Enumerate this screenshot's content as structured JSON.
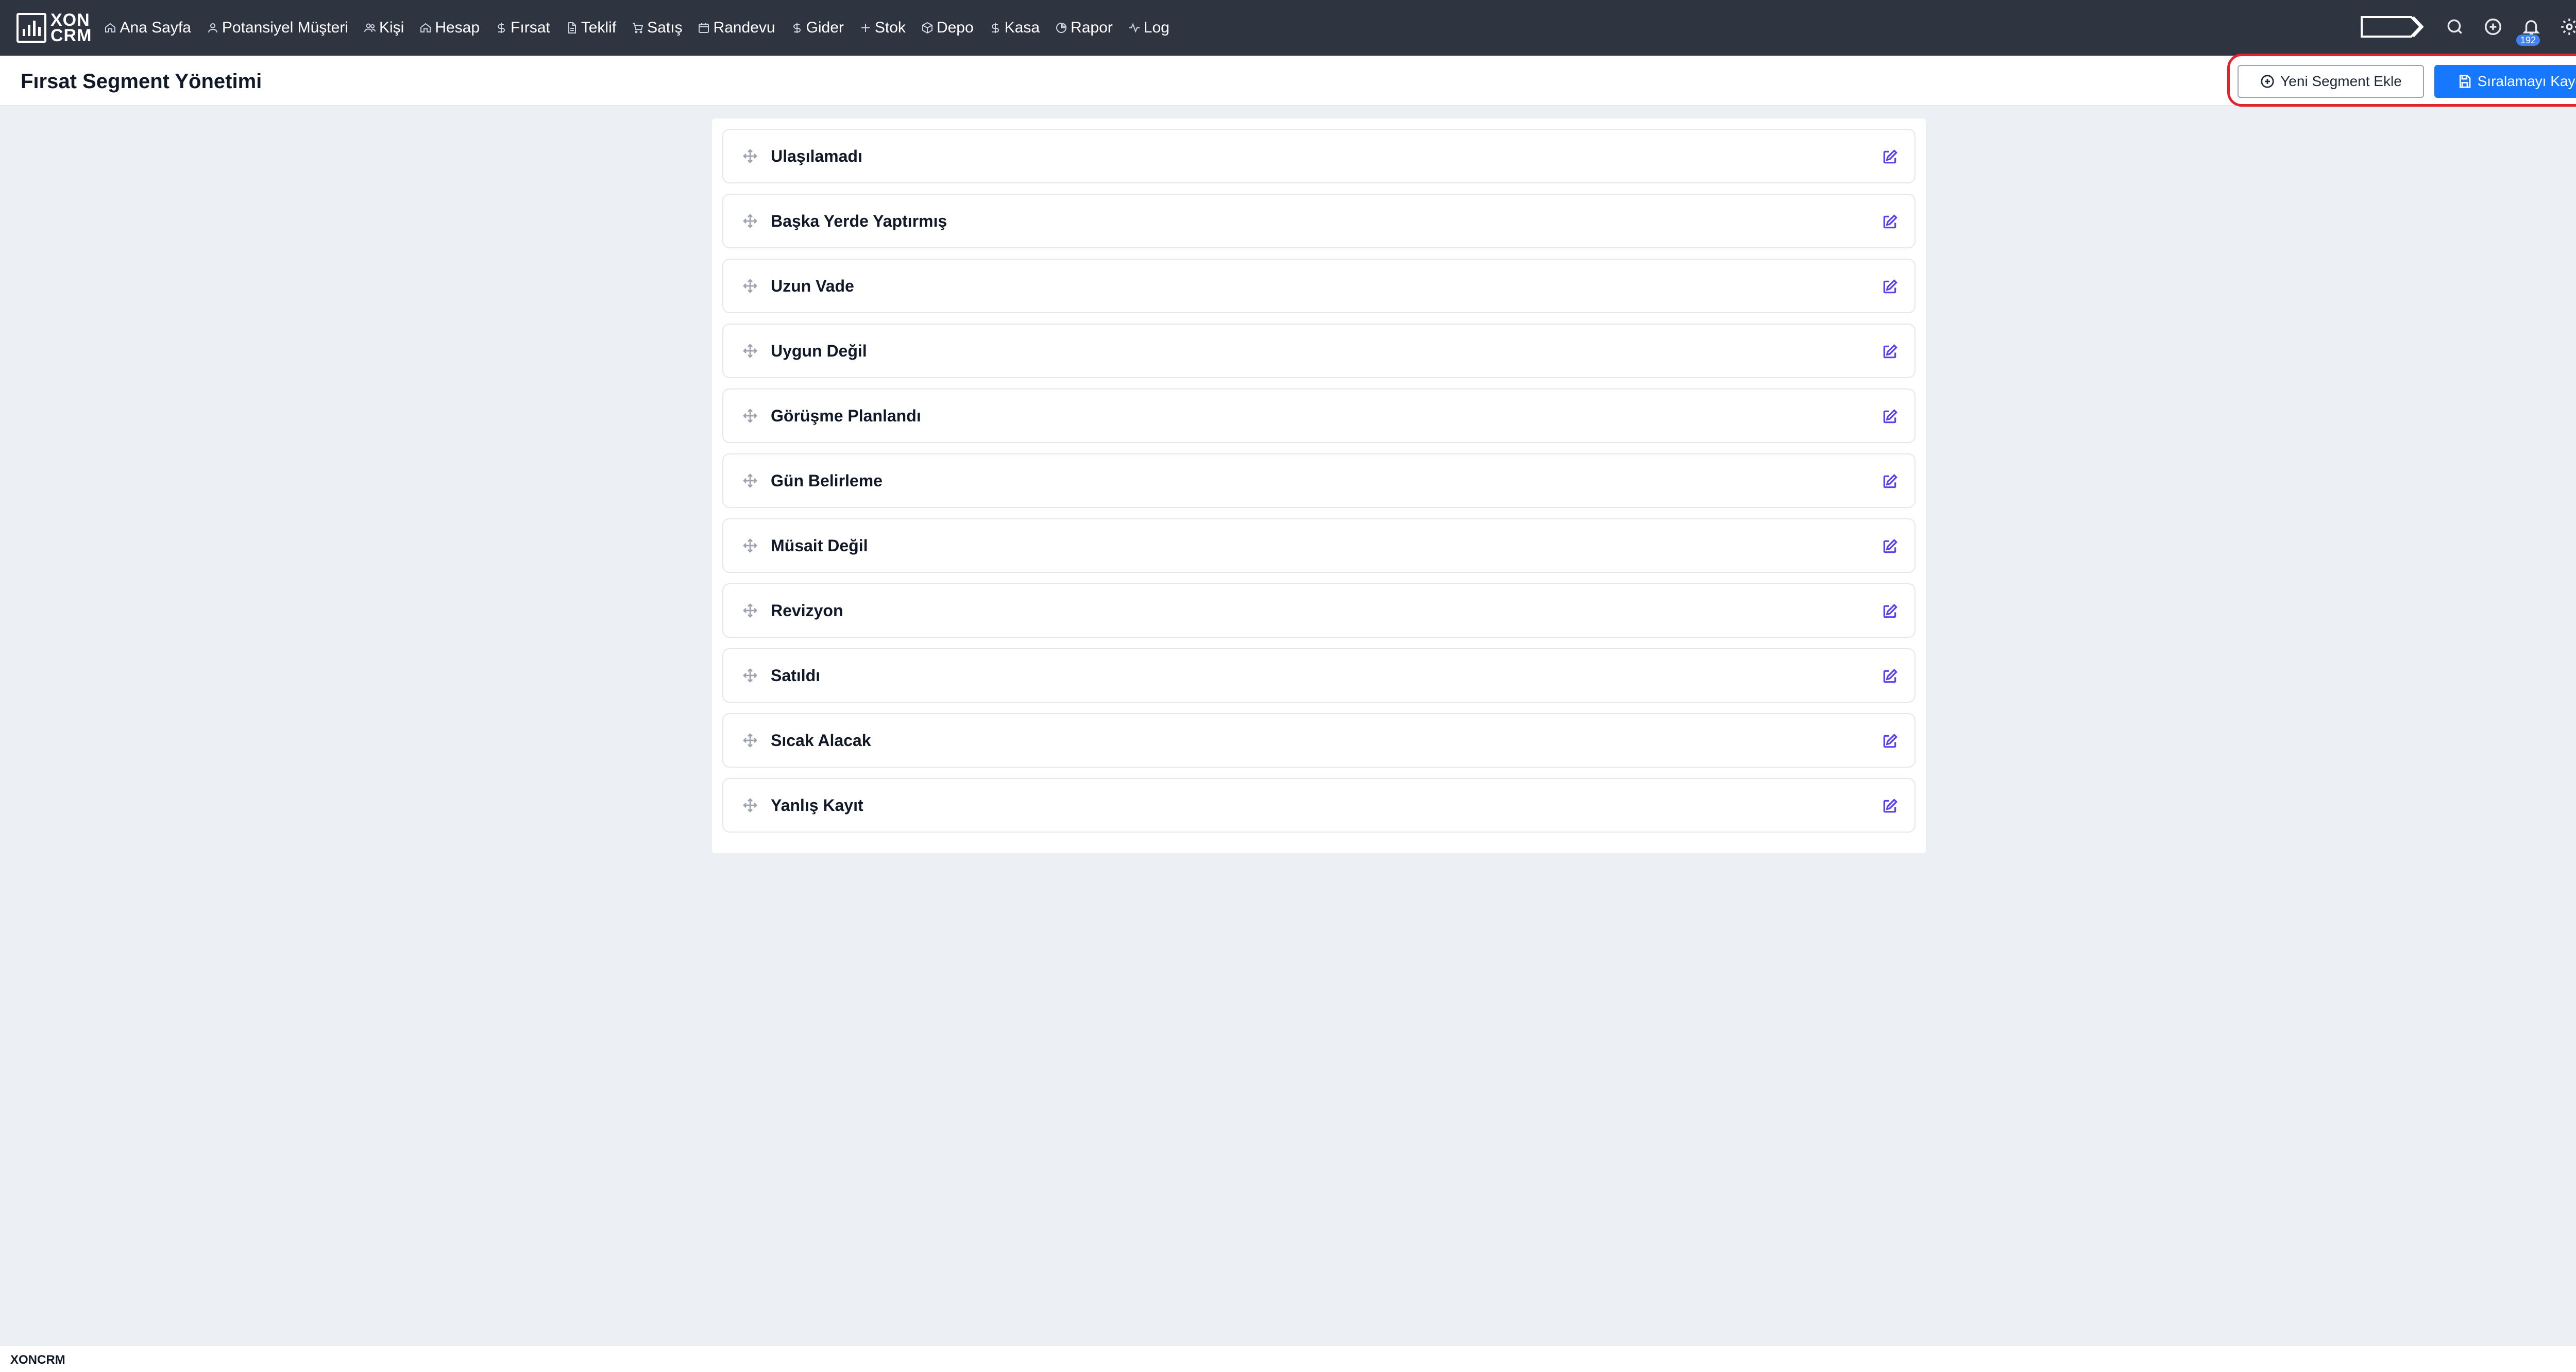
{
  "app": {
    "logo_line1": "XON",
    "logo_line2": "CRM",
    "brand_color": "#2f3441",
    "accent_color": "#1677ff",
    "highlight_color": "#e0242c"
  },
  "nav": {
    "items": [
      {
        "label": "Ana Sayfa",
        "icon": "home-icon"
      },
      {
        "label": "Potansiyel Müşteri",
        "icon": "user-icon"
      },
      {
        "label": "Kişi",
        "icon": "users-icon"
      },
      {
        "label": "Hesap",
        "icon": "home-icon"
      },
      {
        "label": "Fırsat",
        "icon": "dollar-icon"
      },
      {
        "label": "Teklif",
        "icon": "document-icon"
      },
      {
        "label": "Satış",
        "icon": "cart-icon"
      },
      {
        "label": "Randevu",
        "icon": "calendar-icon"
      },
      {
        "label": "Gider",
        "icon": "dollar-icon"
      },
      {
        "label": "Stok",
        "icon": "plus-icon"
      },
      {
        "label": "Depo",
        "icon": "box-icon"
      },
      {
        "label": "Kasa",
        "icon": "dollar-icon"
      },
      {
        "label": "Rapor",
        "icon": "pie-chart-icon"
      },
      {
        "label": "Log",
        "icon": "activity-icon"
      }
    ],
    "notification_count": "192"
  },
  "page": {
    "title": "Fırsat Segment Yönetimi",
    "add_button": "Yeni Segment Ekle",
    "save_button": "Sıralamayı Kaydet"
  },
  "segments": [
    "Ulaşılamadı",
    "Başka Yerde Yaptırmış",
    "Uzun Vade",
    "Uygun Değil",
    "Görüşme Planlandı",
    "Gün Belirleme",
    "Müsait Değil",
    "Revizyon",
    "Satıldı",
    "Sıcak Alacak",
    "Yanlış Kayıt"
  ],
  "footer": {
    "text": "XONCRM"
  }
}
